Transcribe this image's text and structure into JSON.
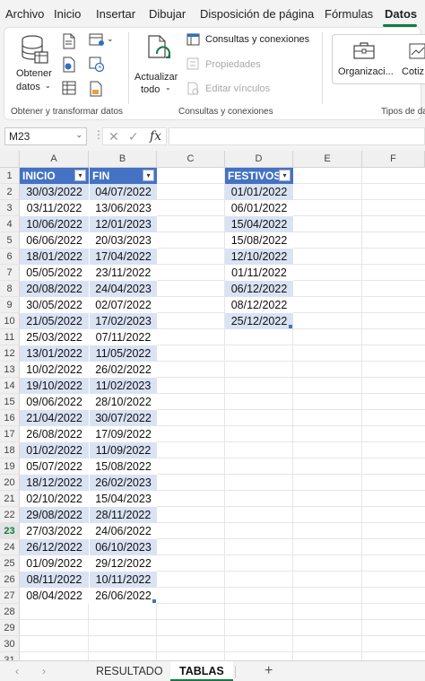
{
  "menu": {
    "items": [
      "Archivo",
      "Inicio",
      "Insertar",
      "Dibujar",
      "Disposición de página",
      "Fórmulas",
      "Datos"
    ],
    "active": "Datos"
  },
  "ribbon": {
    "get_data_label_1": "Obtener",
    "get_data_label_2": "datos",
    "group1_label": "Obtener y transformar datos",
    "refresh_label_1": "Actualizar",
    "refresh_label_2": "todo",
    "queries_label": "Consultas y conexiones",
    "properties_label": "Propiedades",
    "edit_links_label": "Editar vínculos",
    "group2_label": "Consultas y conexiones",
    "organization_label": "Organizaci...",
    "quotes_label": "Cotiz",
    "group3_label": "Tipos de da"
  },
  "formula_bar": {
    "name_box": "M23",
    "formula": ""
  },
  "columns": [
    "A",
    "B",
    "C",
    "D",
    "E",
    "F"
  ],
  "rows": [
    "1",
    "2",
    "3",
    "4",
    "5",
    "6",
    "7",
    "8",
    "9",
    "10",
    "11",
    "12",
    "13",
    "14",
    "15",
    "16",
    "17",
    "18",
    "19",
    "20",
    "21",
    "22",
    "23",
    "24",
    "25",
    "26",
    "27",
    "28",
    "29",
    "30",
    "31"
  ],
  "selected_row": "23",
  "table1": {
    "headers": [
      "INICIO",
      "FIN"
    ],
    "rows": [
      [
        "30/03/2022",
        "04/07/2022"
      ],
      [
        "03/11/2022",
        "13/06/2023"
      ],
      [
        "10/06/2022",
        "12/01/2023"
      ],
      [
        "06/06/2022",
        "20/03/2023"
      ],
      [
        "18/01/2022",
        "17/04/2022"
      ],
      [
        "05/05/2022",
        "23/11/2022"
      ],
      [
        "20/08/2022",
        "24/04/2023"
      ],
      [
        "30/05/2022",
        "02/07/2022"
      ],
      [
        "21/05/2022",
        "17/02/2023"
      ],
      [
        "25/03/2022",
        "07/11/2022"
      ],
      [
        "13/01/2022",
        "11/05/2022"
      ],
      [
        "10/02/2022",
        "26/02/2022"
      ],
      [
        "19/10/2022",
        "11/02/2023"
      ],
      [
        "09/06/2022",
        "28/10/2022"
      ],
      [
        "21/04/2022",
        "30/07/2022"
      ],
      [
        "26/08/2022",
        "17/09/2022"
      ],
      [
        "01/02/2022",
        "11/09/2022"
      ],
      [
        "05/07/2022",
        "15/08/2022"
      ],
      [
        "18/12/2022",
        "26/02/2023"
      ],
      [
        "02/10/2022",
        "15/04/2023"
      ],
      [
        "29/08/2022",
        "28/11/2022"
      ],
      [
        "27/03/2022",
        "24/06/2022"
      ],
      [
        "26/12/2022",
        "06/10/2023"
      ],
      [
        "01/09/2022",
        "29/12/2022"
      ],
      [
        "08/11/2022",
        "10/11/2022"
      ],
      [
        "08/04/2022",
        "26/06/2022"
      ]
    ]
  },
  "table2": {
    "header": "FESTIVOS",
    "values": [
      "01/01/2022",
      "06/01/2022",
      "15/04/2022",
      "15/08/2022",
      "12/10/2022",
      "01/11/2022",
      "06/12/2022",
      "08/12/2022",
      "25/12/2022"
    ]
  },
  "sheet_tabs": {
    "tabs": [
      "RESULTADO",
      "TABLAS"
    ],
    "active": "TABLAS",
    "add": "+"
  },
  "colors": {
    "table_header": "#4472c4",
    "band": "#dae3f3",
    "accent": "#107c41"
  }
}
